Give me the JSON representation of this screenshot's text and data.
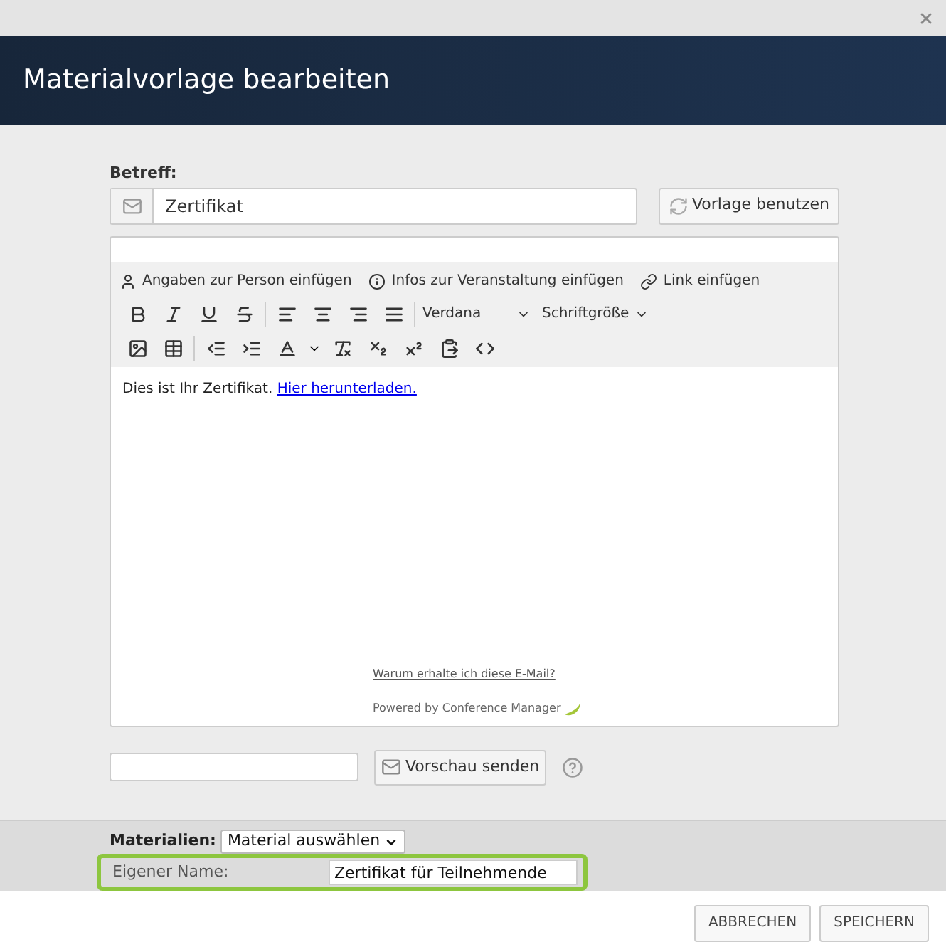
{
  "window": {
    "title": "Materialvorlage bearbeiten"
  },
  "subject": {
    "label": "Betreff:",
    "value": "Zertifikat",
    "template_button": "Vorlage benutzen"
  },
  "editor": {
    "insert_buttons": [
      "Angaben zur Person einfügen",
      "Infos zur Veranstaltung einfügen",
      "Link einfügen"
    ],
    "font": "Verdana",
    "font_size": "Schriftgröße",
    "body_text": "Dies ist Ihr Zertifikat.",
    "body_link": "Hier herunterladen.",
    "footer_link": "Warum erhalte ich diese E-Mail?",
    "powered_by": "Powered by Conference Manager"
  },
  "preview": {
    "button": "Vorschau senden"
  },
  "materials": {
    "label": "Materialien:",
    "select": "Material auswählen"
  },
  "custom_name": {
    "label": "Eigener Name:",
    "value": "Zertifikat für Teilnehmende",
    "highlighted": true
  },
  "buttons": [
    "ABBRECHEN",
    "SPEICHERN"
  ]
}
